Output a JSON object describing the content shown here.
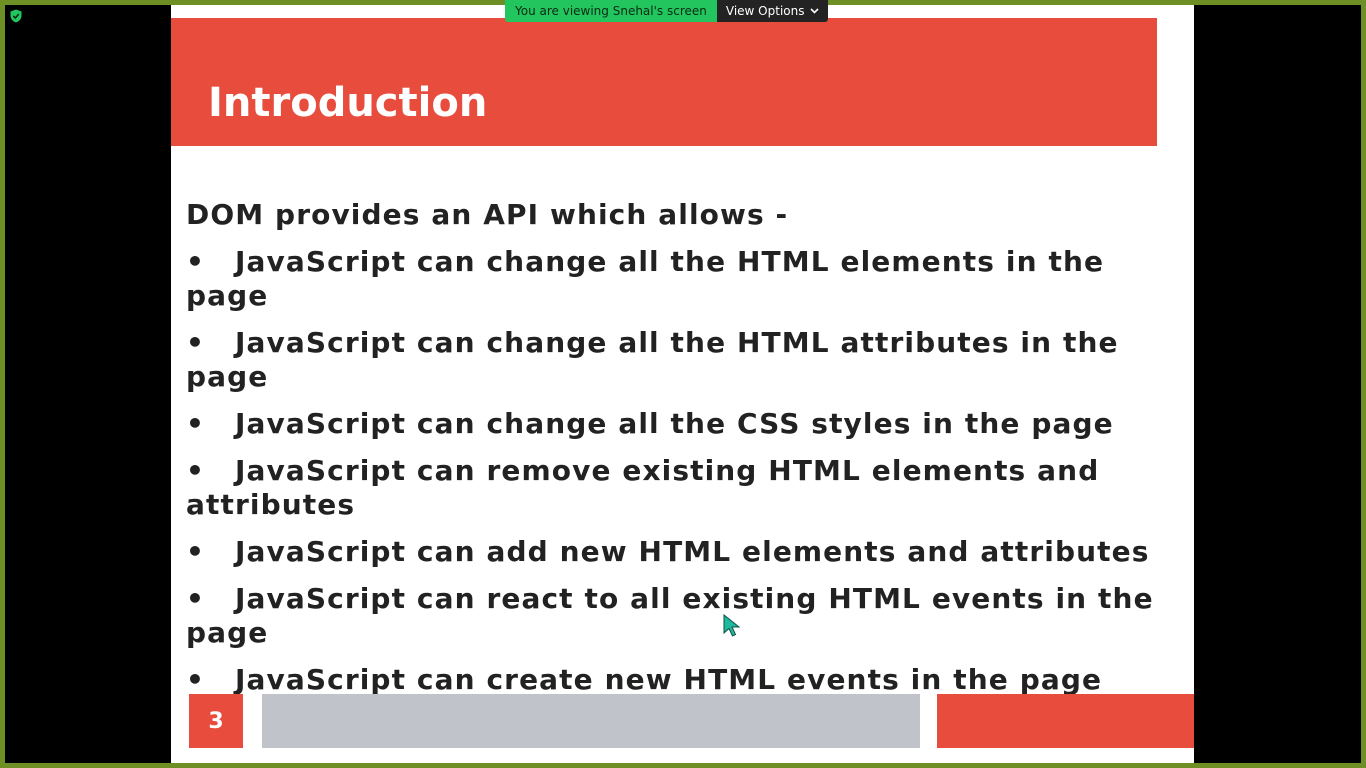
{
  "share_banner": {
    "viewing_text": "You are viewing Snehal's screen",
    "view_options_label": "View Options"
  },
  "slide": {
    "title": "Introduction",
    "intro": "DOM provides an API which allows -",
    "bullet_char": "•",
    "bullets": [
      "JavaScript can change all the HTML elements in the page",
      "JavaScript can change all the HTML attributes in the page",
      "JavaScript can change all the CSS styles in the page",
      "JavaScript can remove existing HTML elements and attributes",
      "JavaScript can add new HTML elements and attributes",
      "JavaScript can react to all existing HTML events in the page",
      "JavaScript can create new HTML events in the page"
    ],
    "page_number": "3"
  },
  "colors": {
    "accent_red": "#e84c3d",
    "footer_gray": "#c0c3c9",
    "banner_green": "#22c55e",
    "frame_green": "#6e8f25"
  },
  "icons": {
    "security": "shield-check-icon",
    "dropdown": "chevron-down-icon",
    "pointer": "mouse-cursor-icon"
  }
}
